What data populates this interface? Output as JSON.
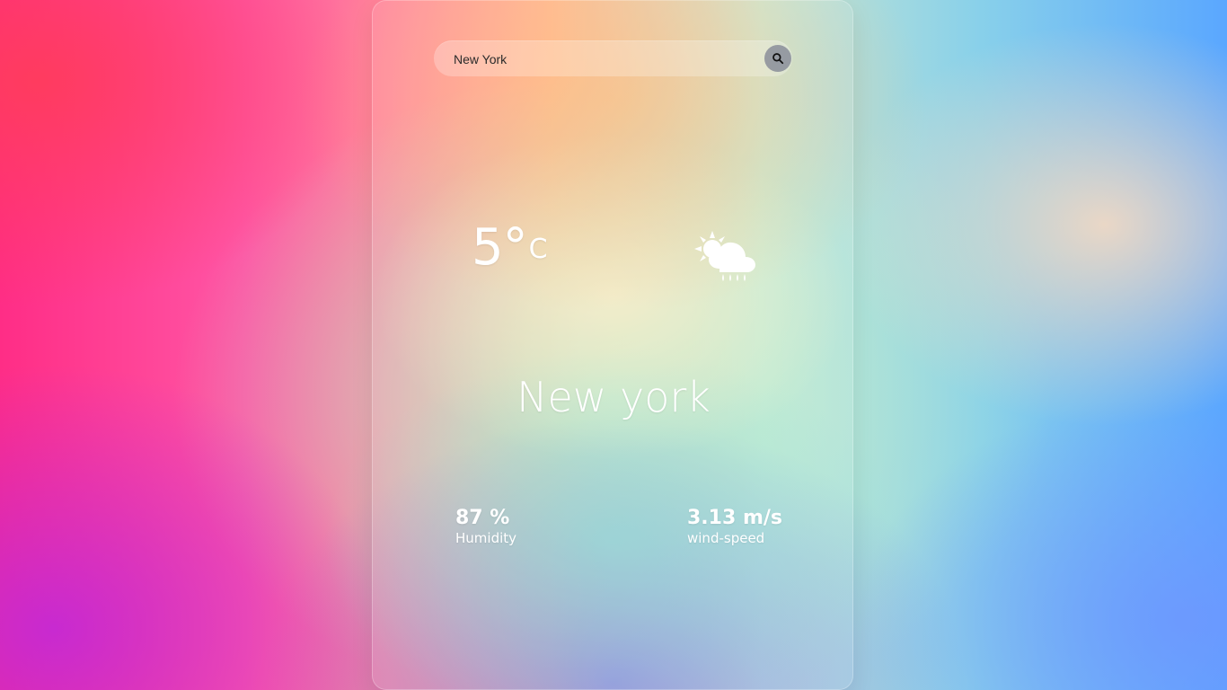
{
  "search": {
    "value": "New York",
    "placeholder": "",
    "button_icon": "search-icon"
  },
  "weather": {
    "temperature_value": "5°",
    "temperature_unit": "C",
    "icon": "partly-cloudy-rain-icon",
    "city": "New york",
    "humidity_value": "87 %",
    "humidity_label": "Humidity",
    "wind_value": "3.13 m/s",
    "wind_label": "wind-speed"
  },
  "colors": {
    "text": "#ffffff",
    "search_button": "#7d8291"
  }
}
